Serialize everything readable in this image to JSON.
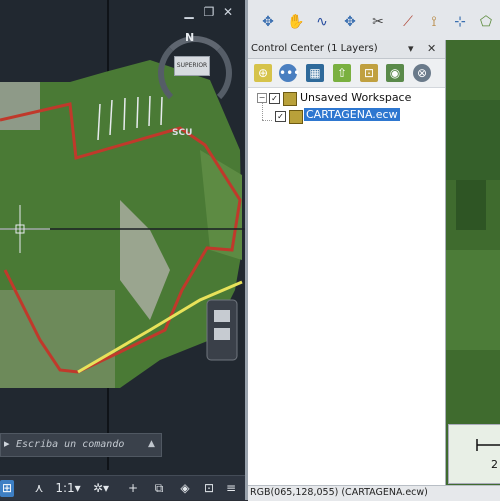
{
  "cad": {
    "compass": {
      "north_label": "N",
      "face_label": "SUPERIOR"
    },
    "view_label": "SCU",
    "command_prefix": "▸",
    "command_placeholder": "Escriba un comando",
    "status_items": [
      {
        "name": "snap-grid-icon",
        "glyph": "⊞",
        "active": true
      },
      {
        "name": "north-icon",
        "glyph": "⋏",
        "active": false
      },
      {
        "name": "scale-selector",
        "glyph": "1:1▾",
        "active": false
      },
      {
        "name": "gear-icon",
        "glyph": "✲▾",
        "active": false
      },
      {
        "name": "plus-icon",
        "glyph": "+",
        "active": false
      },
      {
        "name": "ucs-icon",
        "glyph": "⧉",
        "active": false
      },
      {
        "name": "layers-icon",
        "glyph": "◈",
        "active": false
      },
      {
        "name": "fullscreen-icon",
        "glyph": "⊡",
        "active": false
      },
      {
        "name": "menu-icon",
        "glyph": "≡",
        "active": false
      }
    ],
    "colors": {
      "boundary": "#c0392b",
      "road": "#e8e25a"
    }
  },
  "gis": {
    "panel_title": "Control Center (1 Layers)",
    "panel_controls": [
      "▾",
      "✕"
    ],
    "tree": {
      "workspace_label": "Unsaved Workspace",
      "layer_label": "CARTAGENA.ecw"
    },
    "status_text": "RGB(065,128,055) (CARTAGENA.ecw)",
    "scale_text": "2",
    "colors": {
      "selection": "#2e77d0",
      "map": "#3f6b2e"
    }
  }
}
